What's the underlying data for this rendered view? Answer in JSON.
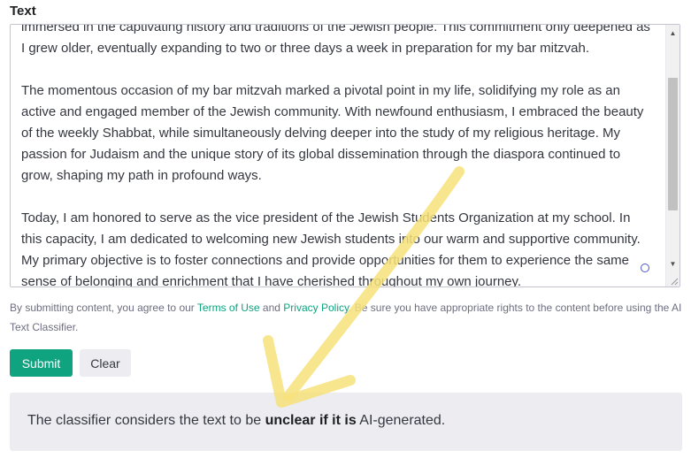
{
  "field": {
    "label": "Text"
  },
  "textarea": {
    "top_partial_line": "immersed in the captivating history and traditions of the Jewish people. This commitment only deepened as",
    "paragraphs": [
      "I grew older, eventually expanding to two or three days a week in preparation for my bar mitzvah.",
      "The momentous occasion of my bar mitzvah marked a pivotal point in my life, solidifying my role as an active and engaged member of the Jewish community. With newfound enthusiasm, I embraced the beauty of the weekly Shabbat, while simultaneously delving deeper into the study of my religious heritage. My passion for Judaism and the unique story of its global dissemination through the diaspora continued to grow, shaping my path in profound ways.",
      "Today, I am honored to serve as the vice president of the Jewish Students Organization at my school. In this capacity, I am dedicated to welcoming new Jewish students into our warm and supportive community. My primary objective is to foster connections and provide opportunities for them to experience the same sense of belonging and enrichment that I have cherished throughout my own journey."
    ]
  },
  "disclaimer": {
    "prefix": "By submitting content, you agree to our ",
    "terms_link": "Terms of Use",
    "middle": " and ",
    "privacy_link": "Privacy Policy",
    "suffix": ". Be sure you have appropriate rights to the content before using the AI Text Classifier."
  },
  "buttons": {
    "submit": "Submit",
    "clear": "Clear"
  },
  "result": {
    "prefix": "The classifier considers the text to be ",
    "verdict": "unclear if it is",
    "suffix": " AI-generated."
  },
  "colors": {
    "accent": "#10a37f",
    "result_bg": "#ececf1",
    "annotation_arrow": "#f7e27a"
  },
  "icons": {
    "scroll_up": "scroll-up-arrow-icon",
    "scroll_down": "scroll-down-arrow-icon",
    "resize": "resize-grip-icon",
    "grammar": "grammar-checker-icon",
    "annotation": "annotation-arrow-icon"
  }
}
